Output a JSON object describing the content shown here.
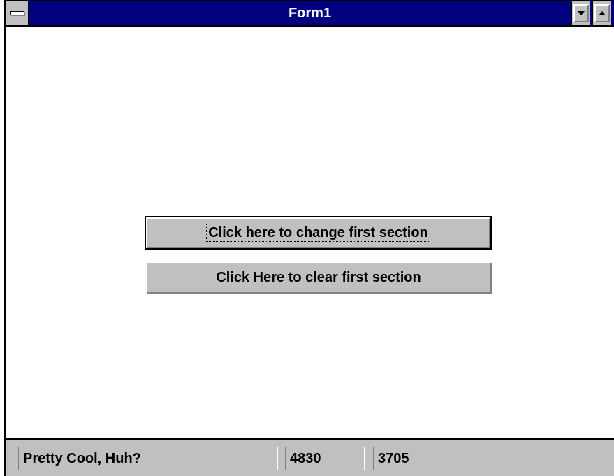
{
  "window": {
    "title": "Form1"
  },
  "buttons": {
    "change_label": "Click here to change first section",
    "clear_label": "Click Here to clear first section"
  },
  "status": {
    "message": "Pretty Cool, Huh?",
    "x": "4830",
    "y": "3705"
  },
  "icons": {
    "system_menu": "system-menu-icon",
    "minimize": "minimize-icon",
    "maximize": "maximize-icon"
  },
  "colors": {
    "titlebar": "#000080",
    "button_face": "#c0c0c0"
  }
}
